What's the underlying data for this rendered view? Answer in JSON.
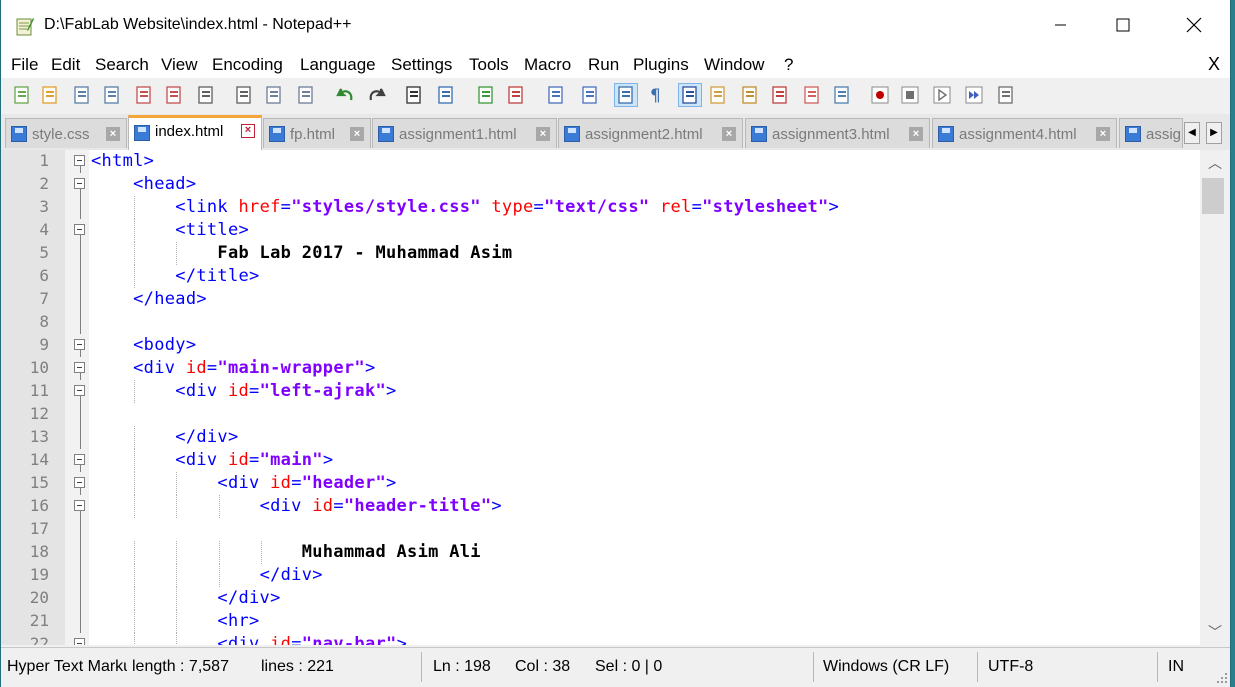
{
  "window": {
    "title": "D:\\FabLab Website\\index.html - Notepad++"
  },
  "menu": [
    "File",
    "Edit",
    "Search",
    "View",
    "Encoding",
    "Language",
    "Settings",
    "Tools",
    "Macro",
    "Run",
    "Plugins",
    "Window",
    "?"
  ],
  "menu_close": "X",
  "tabs": [
    {
      "label": "style.css",
      "active": false
    },
    {
      "label": "index.html",
      "active": true
    },
    {
      "label": "fp.html",
      "active": false
    },
    {
      "label": "assignment1.html",
      "active": false
    },
    {
      "label": "assignment2.html",
      "active": false
    },
    {
      "label": "assignment3.html",
      "active": false
    },
    {
      "label": "assignment4.html",
      "active": false
    },
    {
      "label": "assig",
      "active": false
    }
  ],
  "toolbar_icons": [
    "new-file-icon",
    "open-file-icon",
    "save-icon",
    "save-all-icon",
    "close-icon",
    "close-all-icon",
    "print-icon",
    "cut-icon",
    "copy-icon",
    "paste-icon",
    "undo-icon",
    "redo-icon",
    "find-icon",
    "replace-icon",
    "zoom-in-icon",
    "zoom-out-icon",
    "sync-vertical-icon",
    "sync-horizontal-icon",
    "word-wrap-icon",
    "show-all-characters-icon",
    "indent-guide-icon",
    "user-defined-language-icon",
    "document-map-icon",
    "function-list-icon",
    "folder-workspace-icon",
    "monitoring-icon",
    "record-macro-icon",
    "stop-recording-icon",
    "play-macro-icon",
    "run-macro-multiple-icon",
    "save-macro-icon"
  ],
  "editor": {
    "lines": [
      {
        "n": "1",
        "ind": 0,
        "fold": "box",
        "tokens": [
          [
            "tag",
            "<html>"
          ]
        ]
      },
      {
        "n": "2",
        "ind": 1,
        "fold": "box",
        "tokens": [
          [
            "tag",
            "<head>"
          ]
        ]
      },
      {
        "n": "3",
        "ind": 2,
        "fold": "line",
        "tokens": [
          [
            "tag",
            "<link "
          ],
          [
            "attr",
            "href"
          ],
          [
            "tag",
            "="
          ],
          [
            "val",
            "\"styles/style.css\""
          ],
          [
            "tag",
            " "
          ],
          [
            "attr",
            "type"
          ],
          [
            "tag",
            "="
          ],
          [
            "val",
            "\"text/css\""
          ],
          [
            "tag",
            " "
          ],
          [
            "attr",
            "rel"
          ],
          [
            "tag",
            "="
          ],
          [
            "val",
            "\"stylesheet\""
          ],
          [
            "tag",
            ">"
          ]
        ]
      },
      {
        "n": "4",
        "ind": 2,
        "fold": "box",
        "tokens": [
          [
            "tag",
            "<title>"
          ]
        ]
      },
      {
        "n": "5",
        "ind": 3,
        "fold": "line",
        "tokens": [
          [
            "txt",
            "Fab Lab 2017 - Muhammad Asim"
          ]
        ]
      },
      {
        "n": "6",
        "ind": 2,
        "fold": "line",
        "tokens": [
          [
            "tag",
            "</title>"
          ]
        ]
      },
      {
        "n": "7",
        "ind": 1,
        "fold": "line",
        "tokens": [
          [
            "tag",
            "</head>"
          ]
        ]
      },
      {
        "n": "8",
        "ind": 0,
        "fold": "line",
        "tokens": []
      },
      {
        "n": "9",
        "ind": 1,
        "fold": "box",
        "tokens": [
          [
            "tag",
            "<body>"
          ]
        ]
      },
      {
        "n": "10",
        "ind": 1,
        "fold": "box",
        "tokens": [
          [
            "tag",
            "<div "
          ],
          [
            "attr",
            "id"
          ],
          [
            "tag",
            "="
          ],
          [
            "val",
            "\"main-wrapper\""
          ],
          [
            "tag",
            ">"
          ]
        ]
      },
      {
        "n": "11",
        "ind": 2,
        "fold": "box",
        "tokens": [
          [
            "tag",
            "<div "
          ],
          [
            "attr",
            "id"
          ],
          [
            "tag",
            "="
          ],
          [
            "val",
            "\"left-ajrak\""
          ],
          [
            "tag",
            ">"
          ]
        ]
      },
      {
        "n": "12",
        "ind": 0,
        "fold": "line",
        "tokens": []
      },
      {
        "n": "13",
        "ind": 2,
        "fold": "line",
        "tokens": [
          [
            "tag",
            "</div>"
          ]
        ]
      },
      {
        "n": "14",
        "ind": 2,
        "fold": "box",
        "tokens": [
          [
            "tag",
            "<div "
          ],
          [
            "attr",
            "id"
          ],
          [
            "tag",
            "="
          ],
          [
            "val",
            "\"main\""
          ],
          [
            "tag",
            ">"
          ]
        ]
      },
      {
        "n": "15",
        "ind": 3,
        "fold": "box",
        "tokens": [
          [
            "tag",
            "<div "
          ],
          [
            "attr",
            "id"
          ],
          [
            "tag",
            "="
          ],
          [
            "val",
            "\"header\""
          ],
          [
            "tag",
            ">"
          ]
        ]
      },
      {
        "n": "16",
        "ind": 4,
        "fold": "box",
        "tokens": [
          [
            "tag",
            "<div "
          ],
          [
            "attr",
            "id"
          ],
          [
            "tag",
            "="
          ],
          [
            "val",
            "\"header-title\""
          ],
          [
            "tag",
            ">"
          ]
        ]
      },
      {
        "n": "17",
        "ind": 0,
        "fold": "line",
        "tokens": []
      },
      {
        "n": "18",
        "ind": 5,
        "fold": "line",
        "tokens": [
          [
            "txt",
            "Muhammad Asim Ali"
          ]
        ]
      },
      {
        "n": "19",
        "ind": 4,
        "fold": "line",
        "tokens": [
          [
            "tag",
            "</div>"
          ]
        ]
      },
      {
        "n": "20",
        "ind": 3,
        "fold": "line",
        "tokens": [
          [
            "tag",
            "</div>"
          ]
        ]
      },
      {
        "n": "21",
        "ind": 3,
        "fold": "line",
        "tokens": [
          [
            "tag",
            "<hr>"
          ]
        ]
      },
      {
        "n": "22",
        "ind": 3,
        "fold": "box",
        "tokens": [
          [
            "tag",
            "<div "
          ],
          [
            "attr",
            "id"
          ],
          [
            "tag",
            "="
          ],
          [
            "val",
            "\"nav-bar\""
          ],
          [
            "tag",
            ">"
          ]
        ]
      }
    ]
  },
  "status": {
    "language": "Hyper Text Markup Language file",
    "length": "length : 7,587",
    "lines": "lines : 221",
    "ln": "Ln : 198",
    "col": "Col : 38",
    "sel": "Sel : 0 | 0",
    "eol": "Windows (CR LF)",
    "encoding": "UTF-8",
    "mode": "IN"
  },
  "colors": {
    "tag": "#0000ff",
    "attr": "#ff0000",
    "value": "#8000ff",
    "active_tab_accent": "#f6a53b"
  }
}
